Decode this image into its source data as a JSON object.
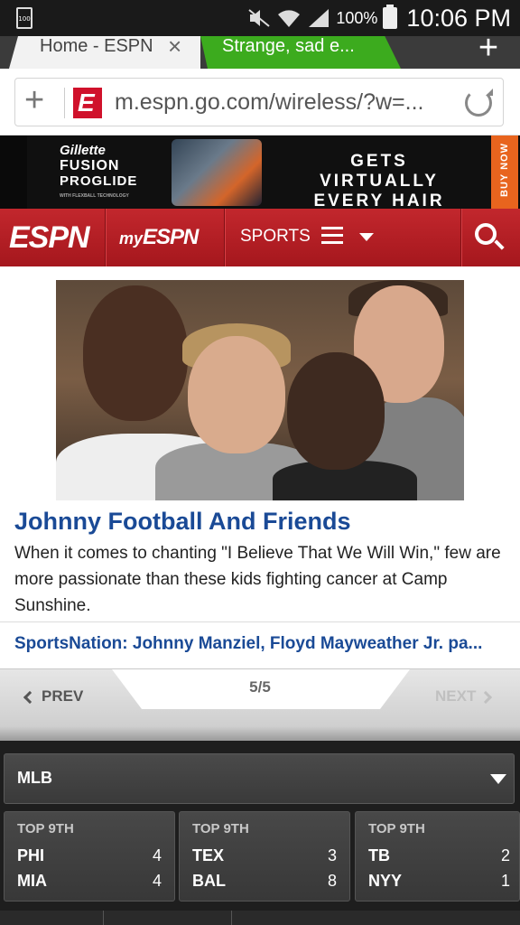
{
  "status_bar": {
    "battery_small": "100",
    "battery_percent": "100%",
    "time": "10:06 PM"
  },
  "tabs": [
    {
      "label": "Home - ESPN",
      "active": true
    },
    {
      "label": "Strange, sad e...",
      "active": false
    }
  ],
  "url_bar": {
    "url": "m.espn.go.com/wireless/?w=..."
  },
  "ad": {
    "brand_line1": "Gillette",
    "brand_line2": "FUSION",
    "brand_line3": "PROGLIDE",
    "brand_small": "WITH FLEXBALL TECHNOLOGY",
    "tagline_line1": "GETS VIRTUALLY",
    "tagline_line2": "EVERY HAIR",
    "cta": "BUY NOW",
    "accent_color": "#e8641e"
  },
  "nav": {
    "logo": "ESPN",
    "my_prefix": "my",
    "my_logo": "ESPN",
    "sports_label": "SPORTS",
    "brand_color": "#c2272d"
  },
  "story": {
    "title": "Johnny Football And Friends",
    "body": "When it comes to chanting \"I Believe That We Will Win,\" few are more passionate than these kids fighting cancer at Camp Sunshine.",
    "link": "SportsNation: Johnny Manziel, Floyd Mayweather Jr. pa..."
  },
  "pager": {
    "prev_label": "PREV",
    "next_label": "NEXT",
    "count": "5/5"
  },
  "scores": {
    "league": "MLB",
    "games": [
      {
        "inning": "TOP 9TH",
        "away": "PHI",
        "away_score": "4",
        "home": "MIA",
        "home_score": "4"
      },
      {
        "inning": "TOP 9TH",
        "away": "TEX",
        "away_score": "3",
        "home": "BAL",
        "home_score": "8"
      },
      {
        "inning": "TOP 9TH",
        "away": "TB",
        "away_score": "2",
        "home": "NYY",
        "home_score": "1"
      }
    ]
  }
}
